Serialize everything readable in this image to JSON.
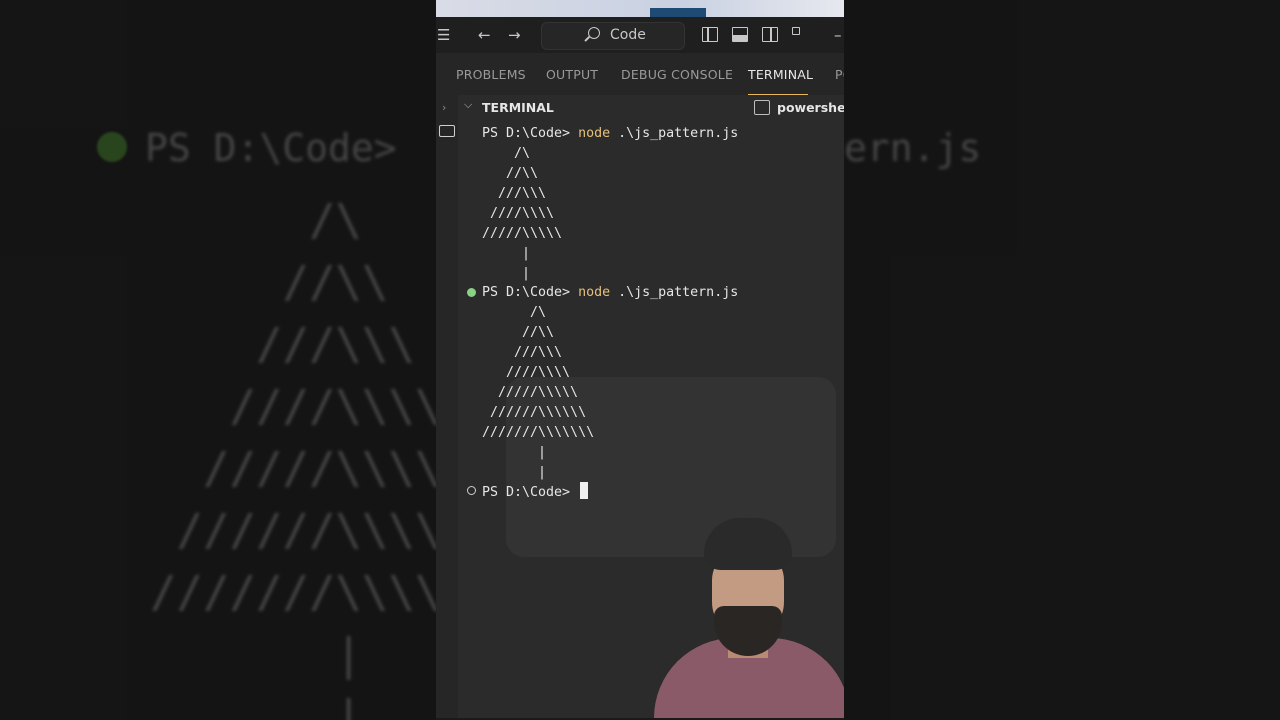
{
  "titlebar": {
    "search_label": "Code"
  },
  "tabs": [
    {
      "label": "PROBLEMS"
    },
    {
      "label": "OUTPUT"
    },
    {
      "label": "DEBUG CONSOLE"
    },
    {
      "label": "TERMINAL",
      "active": true
    },
    {
      "label": "PO"
    }
  ],
  "panel": {
    "title": "TERMINAL",
    "shell": "powershell"
  },
  "terminal": {
    "prompt1": "PS D:\\Code>",
    "cmd_keyword": "node",
    "cmd_arg": ".\\js_pattern.js",
    "tree1": [
      "    /\\",
      "   //\\\\",
      "  ///\\\\\\",
      " ////\\\\\\\\",
      "/////\\\\\\\\\\",
      "     |",
      "     |"
    ],
    "prompt2": "PS D:\\Code>",
    "tree2": [
      "      /\\",
      "     //\\\\",
      "    ///\\\\\\",
      "   ////\\\\\\\\",
      "  /////\\\\\\\\\\",
      " //////\\\\\\\\\\\\",
      "///////\\\\\\\\\\\\\\",
      "       |",
      "       |"
    ],
    "prompt3": "PS D:\\Code>"
  },
  "background": {
    "left_prompt": "PS D:\\Code>",
    "right_text": "ern.js"
  },
  "colors": {
    "accent_tab": "#e7b85a",
    "keyword": "#e5c07b",
    "success_dot": "#89d185"
  }
}
